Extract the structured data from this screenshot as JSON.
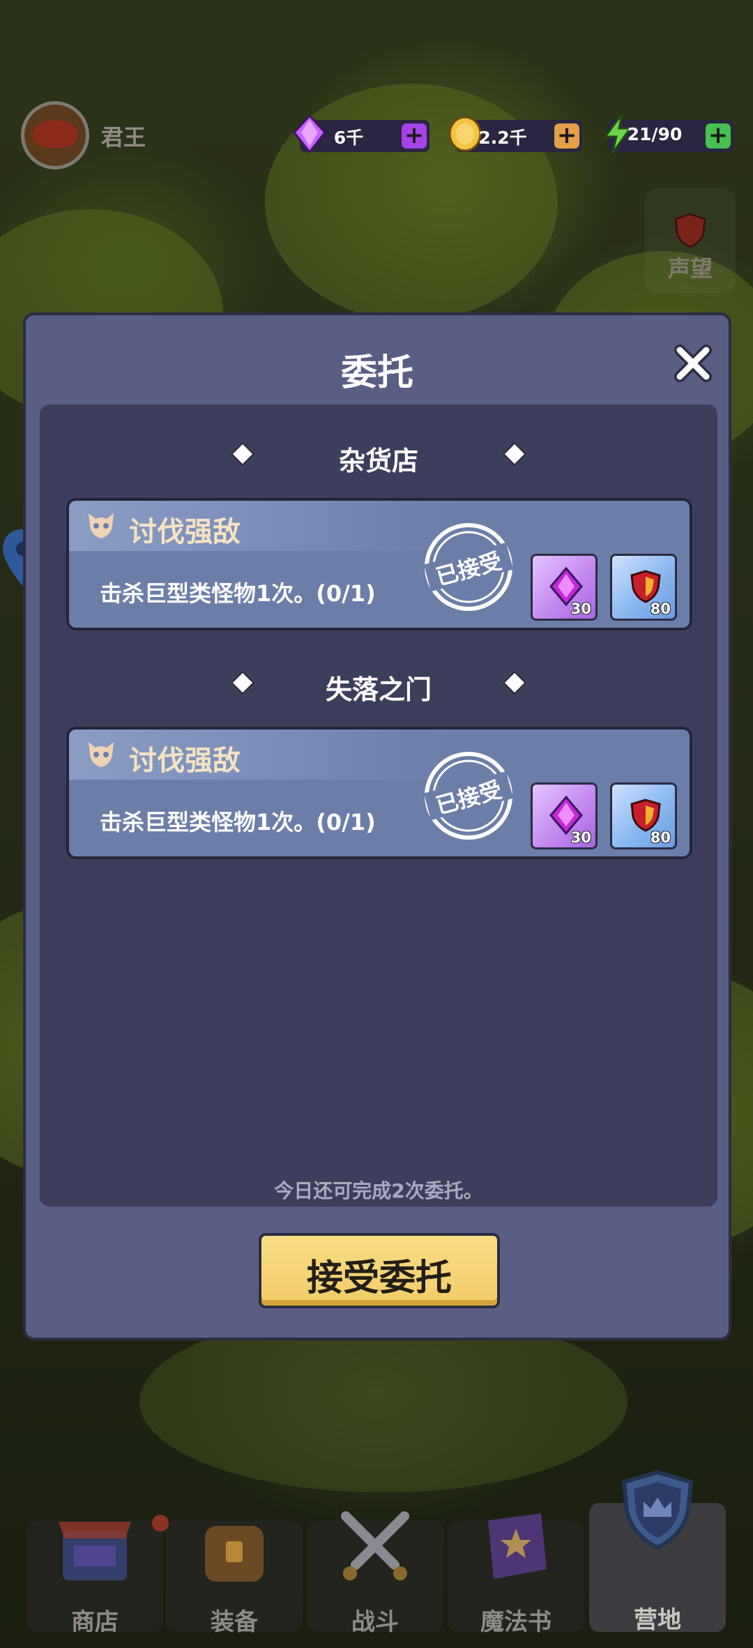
{
  "player": {
    "name": "君王"
  },
  "resources": [
    {
      "name": "gem",
      "value": "6千",
      "color": "#b44cf0"
    },
    {
      "name": "gold",
      "value": "2.2千",
      "color": "#e0a040"
    },
    {
      "name": "energy",
      "value": "21/90",
      "color": "#4cc050"
    }
  ],
  "side": {
    "fame_label": "声望"
  },
  "modal": {
    "title": "委托",
    "sections": [
      {
        "title": "杂货店",
        "quest": {
          "title": "讨伐强敌",
          "desc": "击杀巨型类怪物1次。(0/1)",
          "stamp": "已接受",
          "rewards": [
            {
              "type": "gem",
              "amount": "30"
            },
            {
              "type": "reputation",
              "amount": "80"
            }
          ]
        }
      },
      {
        "title": "失落之门",
        "quest": {
          "title": "讨伐强敌",
          "desc": "击杀巨型类怪物1次。(0/1)",
          "stamp": "已接受",
          "rewards": [
            {
              "type": "gem",
              "amount": "30"
            },
            {
              "type": "reputation",
              "amount": "80"
            }
          ]
        }
      }
    ],
    "footnote": "今日还可完成2次委托。",
    "accept_button": "接受委托"
  },
  "nav": [
    {
      "label": "商店",
      "icon": "shop-icon"
    },
    {
      "label": "装备",
      "icon": "backpack-icon"
    },
    {
      "label": "战斗",
      "icon": "swords-icon"
    },
    {
      "label": "魔法书",
      "icon": "spellbook-icon"
    },
    {
      "label": "营地",
      "icon": "shield-crown-icon",
      "active": true
    }
  ]
}
